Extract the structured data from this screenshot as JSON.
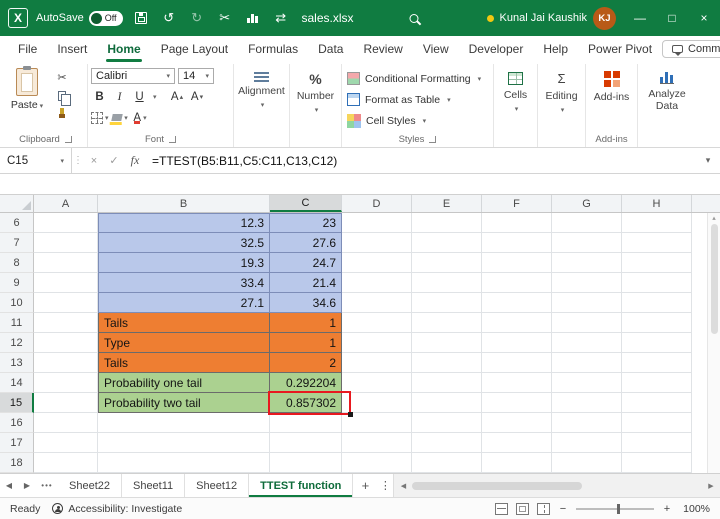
{
  "colors": {
    "titlebar_green": "#107c41",
    "accent_green": "#107c41",
    "selection_red": "#e8191f",
    "cell_blue": "#b9c8ea",
    "cell_orange": "#ee7e32",
    "cell_green": "#abd190"
  },
  "icons": {
    "chev": "▾",
    "scissors": "✂",
    "undo": "↺",
    "redo": "↻",
    "swap": "⇄",
    "cancel": "×",
    "enter": "✓",
    "vdots": "⋮",
    "more": "⋮",
    "nav_left": "◀",
    "nav_right": "▶",
    "tab_overflow": "•••",
    "add": "+",
    "minus": "−",
    "up": "▴",
    "down": "▾",
    "minimize": "—",
    "maximize": "□",
    "close": "×",
    "share_arrow": "↗",
    "percent": "%",
    "sigma": "Σ",
    "logo_letter": "X"
  },
  "titlebar": {
    "autosave_label": "AutoSave",
    "autosave_state": "Off",
    "filename": "sales.xlsx",
    "user_name": "Kunal Jai Kaushik",
    "user_initials": "KJ"
  },
  "ribbon_tabs": [
    {
      "label": "File"
    },
    {
      "label": "Insert"
    },
    {
      "label": "Home",
      "active": true
    },
    {
      "label": "Page Layout"
    },
    {
      "label": "Formulas"
    },
    {
      "label": "Data"
    },
    {
      "label": "Review"
    },
    {
      "label": "View"
    },
    {
      "label": "Developer"
    },
    {
      "label": "Help"
    },
    {
      "label": "Power Pivot"
    }
  ],
  "comments_label": "Comments",
  "ribbon": {
    "paste": "Paste",
    "clipboard_group": "Clipboard",
    "font_name": "Calibri",
    "font_size": "14",
    "bold": "B",
    "italic": "I",
    "underline": "U",
    "grow_font": "A",
    "shrink_font": "A",
    "font_color": "A",
    "font_group": "Font",
    "alignment": "Alignment",
    "number": "Number",
    "conditional_formatting": "Conditional Formatting",
    "format_as_table": "Format as Table",
    "cell_styles": "Cell Styles",
    "styles_group": "Styles",
    "cells": "Cells",
    "editing": "Editing",
    "addins": "Add-ins",
    "addins_group": "Add-ins",
    "analyze_data": "Analyze Data"
  },
  "formula_bar": {
    "name_box": "C15",
    "fx": "fx",
    "formula": "=TTEST(B5:B11,C5:C11,C13,C12)"
  },
  "sheet": {
    "columns": [
      "A",
      "B",
      "C",
      "D",
      "E",
      "F",
      "G",
      "H"
    ],
    "selected_column": "C",
    "selected_row": 15,
    "selected_cell": "C15",
    "rows": [
      {
        "n": 6,
        "B": "12.3",
        "C": "23",
        "fill": "blue"
      },
      {
        "n": 7,
        "B": "32.5",
        "C": "27.6",
        "fill": "blue"
      },
      {
        "n": 8,
        "B": "19.3",
        "C": "24.7",
        "fill": "blue"
      },
      {
        "n": 9,
        "B": "33.4",
        "C": "21.4",
        "fill": "blue"
      },
      {
        "n": 10,
        "B": "27.1",
        "C": "34.6",
        "fill": "blue"
      },
      {
        "n": 11,
        "B": "Tails",
        "C": "1",
        "fill": "orange"
      },
      {
        "n": 12,
        "B": "Type",
        "C": "1",
        "fill": "orange"
      },
      {
        "n": 13,
        "B": "Tails",
        "C": "2",
        "fill": "orange"
      },
      {
        "n": 14,
        "B": "Probability one tail",
        "C": "0.292204",
        "fill": "green"
      },
      {
        "n": 15,
        "B": "Probability two tail",
        "C": "0.857302",
        "fill": "green",
        "selected": true
      },
      {
        "n": 16,
        "B": "",
        "C": "",
        "fill": ""
      },
      {
        "n": 17,
        "B": "",
        "C": "",
        "fill": ""
      },
      {
        "n": 18,
        "B": "",
        "C": "",
        "fill": ""
      }
    ]
  },
  "sheet_bar": {
    "tabs": [
      {
        "label": "Sheet22"
      },
      {
        "label": "Sheet11"
      },
      {
        "label": "Sheet12"
      },
      {
        "label": "TTEST function",
        "active": true
      }
    ]
  },
  "status_bar": {
    "mode": "Ready",
    "accessibility": "Accessibility: Investigate",
    "zoom": "100%"
  }
}
